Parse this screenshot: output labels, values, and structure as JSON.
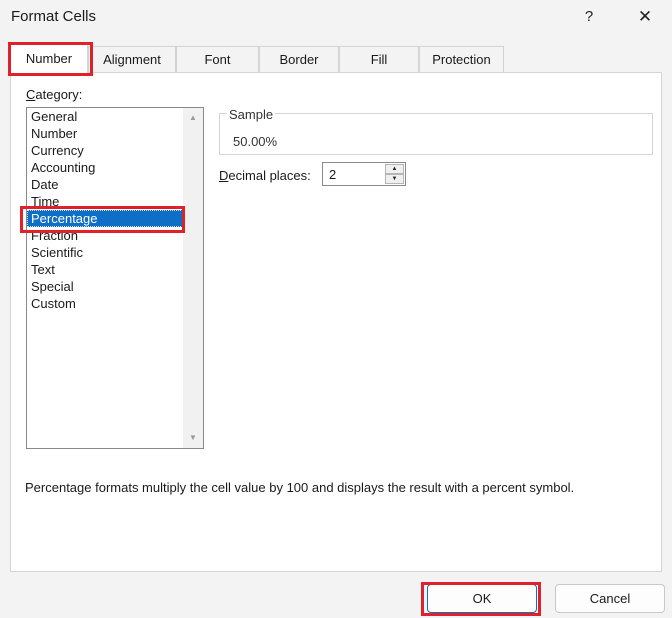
{
  "dialog": {
    "title": "Format Cells",
    "help_label": "?",
    "close_label": "✕"
  },
  "tabs": [
    {
      "label": "Number",
      "active": true
    },
    {
      "label": "Alignment",
      "active": false
    },
    {
      "label": "Font",
      "active": false
    },
    {
      "label": "Border",
      "active": false
    },
    {
      "label": "Fill",
      "active": false
    },
    {
      "label": "Protection",
      "active": false
    }
  ],
  "category": {
    "label_first": "C",
    "label_rest": "ategory:",
    "items": [
      "General",
      "Number",
      "Currency",
      "Accounting",
      "Date",
      "Time",
      "Percentage",
      "Fraction",
      "Scientific",
      "Text",
      "Special",
      "Custom"
    ],
    "selected": "Percentage"
  },
  "sample": {
    "legend": "Sample",
    "value": "50.00%"
  },
  "decimal": {
    "label_first": "D",
    "label_rest": "ecimal places:",
    "value": "2"
  },
  "description": "Percentage formats multiply the cell value by 100 and displays the result with a percent symbol.",
  "buttons": {
    "ok": "OK",
    "cancel": "Cancel"
  },
  "icons": {
    "scroll_up": "scroll-up-arrow-icon",
    "scroll_down": "scroll-down-arrow-icon",
    "spin_up": "spin-up-arrow-icon",
    "spin_down": "spin-down-arrow-icon"
  },
  "colors": {
    "selection": "#0f6fc6",
    "annotation_highlight": "#e0202a",
    "dialog_background": "#f3f3f3"
  }
}
